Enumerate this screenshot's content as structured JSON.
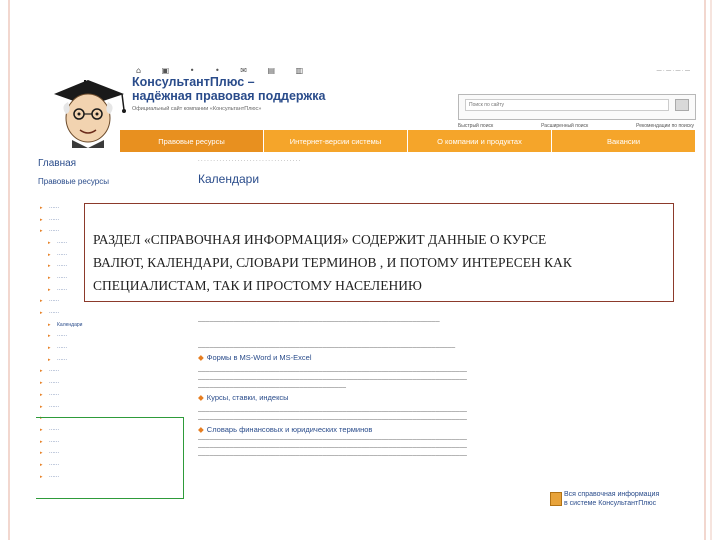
{
  "header": {
    "brand_line1": "КонсультантПлюс –",
    "brand_line2": "надёжная правовая поддержка",
    "brand_sub": "Официальный сайт компании «КонсультантПлюс»",
    "search_placeholder": "Поиск по сайту",
    "search_tabs": [
      "Быстрый поиск",
      "Расширенный поиск",
      "Рекомендации по поиску"
    ]
  },
  "nav": {
    "tabs": [
      "Правовые ресурсы",
      "Интернет-версии системы",
      "О компании и продуктах",
      "Вакансии"
    ]
  },
  "sidebar": {
    "title": "Главная",
    "subtitle": "Правовые ресурсы",
    "highlight_item": "Календари"
  },
  "content": {
    "page_title": "Календари",
    "links": [
      "Формы в MS-Word и MS-Excel",
      "Курсы, ставки, индексы",
      "Словарь финансовых и юридических терминов"
    ]
  },
  "callout": {
    "line1": "РАЗДЕЛ «СПРАВОЧНАЯ ИНФОРМАЦИЯ» СОДЕРЖИТ ДАННЫЕ О КУРСЕ",
    "line2": "ВАЛЮТ, КАЛЕНДАРИ, СЛОВАРИ ТЕРМИНОВ , И ПОТОМУ ИНТЕРЕСЕН КАК",
    "line3": "СПЕЦИАЛИСТАМ, ТАК И ПРОСТОМУ НАСЕЛЕНИЮ"
  },
  "footer": {
    "line1": "Вся справочная информация",
    "line2": "в системе КонсультантПлюс"
  },
  "colors": {
    "nav_orange": "#f5a52a",
    "link_blue": "#2a4c8b",
    "callout_border": "#8c3a2b",
    "highlight_green": "#2e9b3a"
  }
}
